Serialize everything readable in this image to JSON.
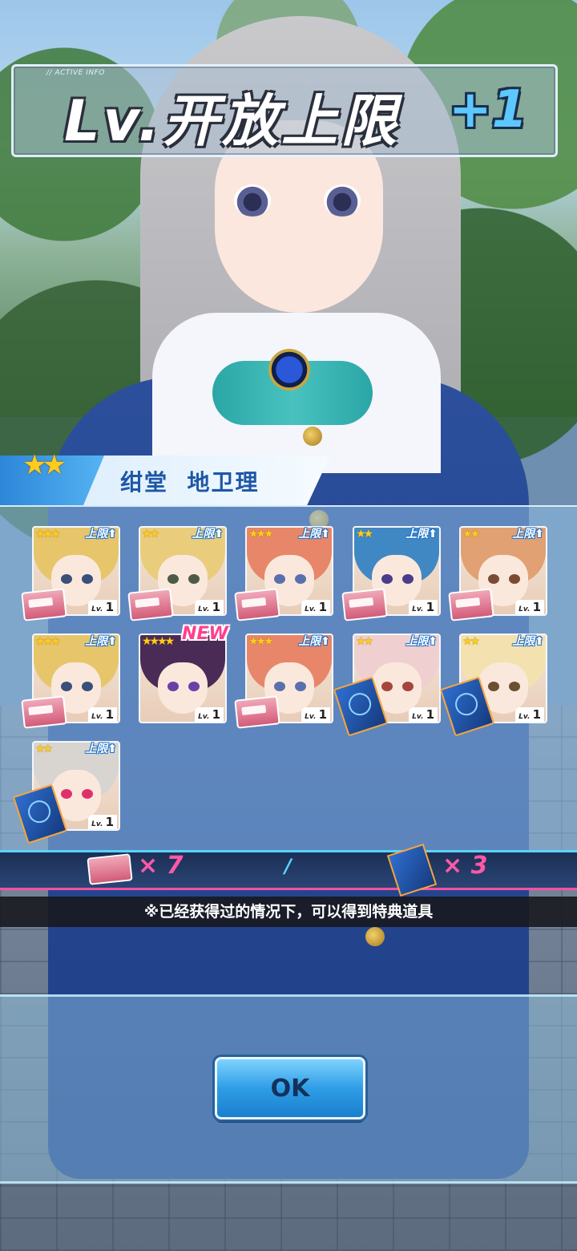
{
  "title": {
    "tag": "// ACTIVE INFO",
    "main": "Lv.开放上限",
    "plus": "+1"
  },
  "character": {
    "stars": "★★",
    "name": "绀堂  地卫理"
  },
  "cards": [
    {
      "stars": "★★★",
      "limit": "上限⬆",
      "lv_prefix": "Lv.",
      "level": "1",
      "item": "ticket",
      "hair": "#e7c56a",
      "eye": "#3a4f7a"
    },
    {
      "stars": "★★",
      "limit": "上限⬆",
      "lv_prefix": "Lv.",
      "level": "1",
      "item": "ticket",
      "hair": "#e9cd7c",
      "eye": "#4d5b46"
    },
    {
      "stars": "★★★",
      "limit": "上限⬆",
      "lv_prefix": "Lv.",
      "level": "1",
      "item": "ticket",
      "hair": "#e8866a",
      "eye": "#5a6fae"
    },
    {
      "stars": "★★",
      "limit": "上限⬆",
      "lv_prefix": "Lv.",
      "level": "1",
      "item": "ticket",
      "hair": "#3f88c4",
      "eye": "#4a3c8a"
    },
    {
      "stars": "★★",
      "limit": "上限⬆",
      "lv_prefix": "Lv.",
      "level": "1",
      "item": "ticket",
      "hair": "#e1a173",
      "eye": "#7a4a32"
    },
    {
      "stars": "★★★",
      "limit": "上限⬆",
      "lv_prefix": "Lv.",
      "level": "1",
      "item": "ticket",
      "hair": "#e7c56a",
      "eye": "#3a4f7a"
    },
    {
      "stars": "★★★★",
      "limit": "",
      "lv_prefix": "Lv.",
      "level": "1",
      "item": "none",
      "hair": "#4a2b55",
      "eye": "#6a3fa8",
      "badge": "NEW"
    },
    {
      "stars": "★★★",
      "limit": "上限⬆",
      "lv_prefix": "Lv.",
      "level": "1",
      "item": "ticket",
      "hair": "#e8866a",
      "eye": "#5a6fae"
    },
    {
      "stars": "★★",
      "limit": "上限⬆",
      "lv_prefix": "Lv.",
      "level": "1",
      "item": "book",
      "hair": "#efcfcf",
      "eye": "#a6453e"
    },
    {
      "stars": "★★",
      "limit": "上限⬆",
      "lv_prefix": "Lv.",
      "level": "1",
      "item": "book",
      "hair": "#f3e2b0",
      "eye": "#6a5030"
    },
    {
      "stars": "★★",
      "limit": "上限⬆",
      "lv_prefix": "Lv.",
      "level": "1",
      "item": "book",
      "hair": "#d8d4d0",
      "eye": "#e0306a"
    }
  ],
  "totals": {
    "ticket_count": "× 7",
    "separator": "/",
    "book_count": "× 3"
  },
  "note": "※已经获得过的情况下，可以得到特典道具",
  "ok_label": "OK",
  "colors": {
    "accent": "#2f9de6",
    "pink": "#ff58a8",
    "star": "#ffcc1e"
  }
}
